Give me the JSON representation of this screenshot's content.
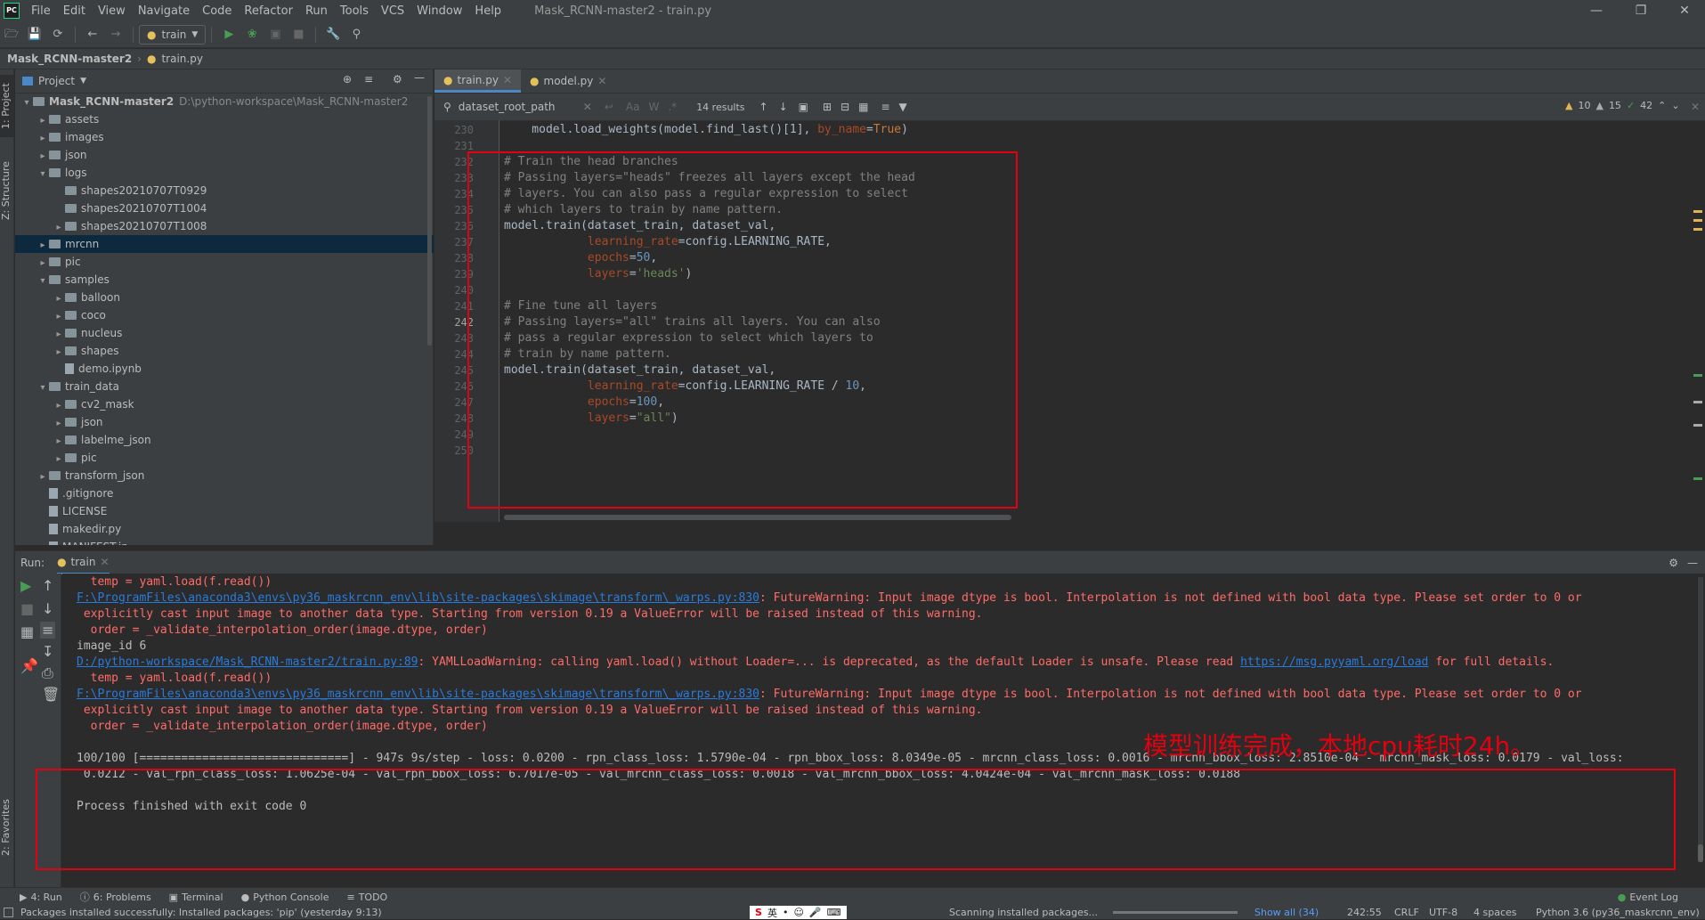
{
  "menu": {
    "app_icon": "PC",
    "items": [
      "File",
      "Edit",
      "View",
      "Navigate",
      "Code",
      "Refactor",
      "Run",
      "Tools",
      "VCS",
      "Window",
      "Help"
    ],
    "window_title": "Mask_RCNN-master2 - train.py",
    "window_controls": [
      "minimize-icon",
      "restore-icon",
      "close-icon"
    ]
  },
  "toolbar": {
    "run_config": "train",
    "icons": [
      "open-icon",
      "save-icon",
      "sync-icon",
      "back-icon",
      "forward-icon",
      "run-icon",
      "debug-icon",
      "coverage-icon",
      "stop-icon",
      "wrench-icon",
      "search-icon"
    ]
  },
  "breadcrumbs": [
    "Mask_RCNN-master2",
    "train.py"
  ],
  "stripe": {
    "project_tab": "1: Project",
    "structure_tab": "Z: Structure",
    "favorites_tab": "2: Favorites"
  },
  "project": {
    "header": "Project",
    "tree": [
      {
        "depth": 0,
        "open": true,
        "type": "folder",
        "label": "Mask_RCNN-master2",
        "path": "D:\\python-workspace\\Mask_RCNN-master2",
        "bold": true
      },
      {
        "depth": 1,
        "open": false,
        "type": "folder",
        "label": "assets"
      },
      {
        "depth": 1,
        "open": false,
        "type": "folder",
        "label": "images"
      },
      {
        "depth": 1,
        "open": false,
        "type": "folder",
        "label": "json"
      },
      {
        "depth": 1,
        "open": true,
        "type": "folder",
        "label": "logs"
      },
      {
        "depth": 2,
        "open": null,
        "type": "folder",
        "label": "shapes20210707T0929"
      },
      {
        "depth": 2,
        "open": null,
        "type": "folder",
        "label": "shapes20210707T1004"
      },
      {
        "depth": 2,
        "open": false,
        "type": "folder",
        "label": "shapes20210707T1008"
      },
      {
        "depth": 1,
        "open": false,
        "type": "folder",
        "label": "mrcnn",
        "selected": true
      },
      {
        "depth": 1,
        "open": false,
        "type": "folder",
        "label": "pic"
      },
      {
        "depth": 1,
        "open": true,
        "type": "folder",
        "label": "samples"
      },
      {
        "depth": 2,
        "open": false,
        "type": "folder",
        "label": "balloon"
      },
      {
        "depth": 2,
        "open": false,
        "type": "folder",
        "label": "coco"
      },
      {
        "depth": 2,
        "open": false,
        "type": "folder",
        "label": "nucleus"
      },
      {
        "depth": 2,
        "open": false,
        "type": "folder",
        "label": "shapes"
      },
      {
        "depth": 2,
        "open": null,
        "type": "file",
        "label": "demo.ipynb"
      },
      {
        "depth": 1,
        "open": true,
        "type": "folder",
        "label": "train_data"
      },
      {
        "depth": 2,
        "open": false,
        "type": "folder",
        "label": "cv2_mask"
      },
      {
        "depth": 2,
        "open": false,
        "type": "folder",
        "label": "json"
      },
      {
        "depth": 2,
        "open": false,
        "type": "folder",
        "label": "labelme_json"
      },
      {
        "depth": 2,
        "open": false,
        "type": "folder",
        "label": "pic"
      },
      {
        "depth": 1,
        "open": false,
        "type": "folder",
        "label": "transform_json"
      },
      {
        "depth": 1,
        "open": null,
        "type": "file",
        "label": ".gitignore"
      },
      {
        "depth": 1,
        "open": null,
        "type": "file",
        "label": "LICENSE"
      },
      {
        "depth": 1,
        "open": null,
        "type": "file",
        "label": "makedir.py"
      },
      {
        "depth": 1,
        "open": null,
        "type": "file",
        "label": "MANIFEST.in"
      }
    ]
  },
  "editor": {
    "tabs": [
      {
        "label": "train.py",
        "active": true
      },
      {
        "label": "model.py",
        "active": false
      }
    ],
    "find": {
      "query": "dataset_root_path",
      "results": "14 results"
    },
    "inspections": {
      "warnings": "10",
      "weak": "15",
      "ok": "42"
    },
    "lines": [
      {
        "n": "230",
        "segs": [
          [
            "    model.load_weights(model.find_last()[1], ",
            "n"
          ],
          [
            "by_name",
            "k"
          ],
          [
            "=",
            "n"
          ],
          [
            "True",
            "c"
          ],
          [
            ")",
            "n"
          ]
        ]
      },
      {
        "n": "231",
        "segs": []
      },
      {
        "n": "232",
        "segs": [
          [
            "# Train the head branches",
            "m"
          ]
        ]
      },
      {
        "n": "233",
        "segs": [
          [
            "# Passing layers=\"heads\" freezes all layers except the head",
            "m"
          ]
        ]
      },
      {
        "n": "234",
        "segs": [
          [
            "# layers. You can also pass a regular expression to select",
            "m"
          ]
        ]
      },
      {
        "n": "235",
        "segs": [
          [
            "# which layers to train by name pattern.",
            "m"
          ]
        ]
      },
      {
        "n": "236",
        "segs": [
          [
            "model.train(dataset_train, dataset_val,",
            "n"
          ]
        ]
      },
      {
        "n": "237",
        "segs": [
          [
            "            ",
            "n"
          ],
          [
            "learning_rate",
            "k"
          ],
          [
            "=config.LEARNING_RATE,",
            "n"
          ]
        ]
      },
      {
        "n": "238",
        "segs": [
          [
            "            ",
            "n"
          ],
          [
            "epochs",
            "k"
          ],
          [
            "=",
            "n"
          ],
          [
            "50",
            "u"
          ],
          [
            ",",
            "n"
          ]
        ]
      },
      {
        "n": "239",
        "segs": [
          [
            "            ",
            "n"
          ],
          [
            "layers",
            "k"
          ],
          [
            "=",
            "n"
          ],
          [
            "'heads'",
            "s"
          ],
          [
            ")",
            "n"
          ]
        ]
      },
      {
        "n": "240",
        "segs": []
      },
      {
        "n": "241",
        "segs": [
          [
            "# Fine tune all layers",
            "m"
          ]
        ]
      },
      {
        "n": "242",
        "segs": [
          [
            "# Passing layers=\"all\" trains all layers. You can also",
            "m"
          ]
        ]
      },
      {
        "n": "243",
        "segs": [
          [
            "# pass a regular expression to select which layers to",
            "m"
          ]
        ]
      },
      {
        "n": "244",
        "segs": [
          [
            "# train by name pattern.",
            "m"
          ]
        ]
      },
      {
        "n": "245",
        "segs": [
          [
            "model.train(dataset_train, dataset_val,",
            "n"
          ]
        ]
      },
      {
        "n": "246",
        "segs": [
          [
            "            ",
            "n"
          ],
          [
            "learning_rate",
            "k"
          ],
          [
            "=config.LEARNING_RATE / ",
            "n"
          ],
          [
            "10",
            "u"
          ],
          [
            ",",
            "n"
          ]
        ]
      },
      {
        "n": "247",
        "segs": [
          [
            "            ",
            "n"
          ],
          [
            "epochs",
            "k"
          ],
          [
            "=",
            "n"
          ],
          [
            "100",
            "u"
          ],
          [
            ",",
            "n"
          ]
        ]
      },
      {
        "n": "248",
        "segs": [
          [
            "            ",
            "n"
          ],
          [
            "layers",
            "k"
          ],
          [
            "=",
            "n"
          ],
          [
            "\"all\"",
            "s"
          ],
          [
            ")",
            "n"
          ]
        ]
      },
      {
        "n": "249",
        "segs": []
      },
      {
        "n": "250",
        "segs": []
      }
    ]
  },
  "run": {
    "label": "Run:",
    "tab": "train",
    "console": [
      [
        [
          "  temp = yaml.load(f.read())",
          "e"
        ]
      ],
      [
        [
          "F:\\ProgramFiles\\anaconda3\\envs\\py36_maskrcnn_env\\lib\\site-packages\\skimage\\transform\\_warps.py:830",
          "l"
        ],
        [
          ": FutureWarning: Input image dtype is bool. Interpolation is not defined with bool data type. Please set order to 0 or",
          "e"
        ]
      ],
      [
        [
          " explicitly cast input image to another data type. Starting from version 0.19 a ValueError will be raised instead of this warning.",
          "e"
        ]
      ],
      [
        [
          "  order = _validate_interpolation_order(image.dtype, order)",
          "e"
        ]
      ],
      [
        [
          "image_id 6",
          "n"
        ]
      ],
      [
        [
          "D:/python-workspace/Mask_RCNN-master2/train.py:89",
          "l"
        ],
        [
          ": YAMLLoadWarning: calling yaml.load() without Loader=... is deprecated, as the default Loader is unsafe. Please read ",
          "e"
        ],
        [
          "https://msg.pyyaml.org/load",
          "l"
        ],
        [
          " for full details.",
          "e"
        ]
      ],
      [
        [
          "  temp = yaml.load(f.read())",
          "e"
        ]
      ],
      [
        [
          "F:\\ProgramFiles\\anaconda3\\envs\\py36_maskrcnn_env\\lib\\site-packages\\skimage\\transform\\_warps.py:830",
          "l"
        ],
        [
          ": FutureWarning: Input image dtype is bool. Interpolation is not defined with bool data type. Please set order to 0 or",
          "e"
        ]
      ],
      [
        [
          " explicitly cast input image to another data type. Starting from version 0.19 a ValueError will be raised instead of this warning.",
          "e"
        ]
      ],
      [
        [
          "  order = _validate_interpolation_order(image.dtype, order)",
          "e"
        ]
      ],
      [],
      [
        [
          "100/100 [==============================] - 947s 9s/step - loss: 0.0200 - rpn_class_loss: 1.5790e-04 - rpn_bbox_loss: 8.0349e-05 - mrcnn_class_loss: 0.0016 - mrcnn_bbox_loss: 2.8510e-04 - mrcnn_mask_loss: 0.0179 - val_loss:",
          "n"
        ]
      ],
      [
        [
          " 0.0212 - val_rpn_class_loss: 1.0625e-04 - val_rpn_bbox_loss: 6.7017e-05 - val_mrcnn_class_loss: 0.0018 - val_mrcnn_bbox_loss: 4.0424e-04 - val_mrcnn_mask_loss: 0.0188",
          "n"
        ]
      ],
      [],
      [
        [
          "Process finished with exit code 0",
          "n"
        ]
      ]
    ],
    "annotation": "模型训练完成，本地cpu耗时24h。"
  },
  "tools": [
    {
      "icon": "run-icon",
      "label": "4: Run"
    },
    {
      "icon": "problems-icon",
      "label": "6: Problems"
    },
    {
      "icon": "terminal-icon",
      "label": "Terminal"
    },
    {
      "icon": "python-icon",
      "label": "Python Console"
    },
    {
      "icon": "todo-icon",
      "label": "TODO"
    }
  ],
  "event_log": "Event Log",
  "status": {
    "message": "Packages installed successfully: Installed packages: 'pip' (yesterday 9:13)",
    "ime": "英",
    "scanning": "Scanning installed packages...",
    "show_all": "Show all (34)",
    "position": "242:55",
    "line_sep": "CRLF",
    "encoding": "UTF-8",
    "indent": "4 spaces",
    "interpreter": "Python 3.6 (py36_maskrcnn_env)"
  },
  "colors": {
    "accent": "#4a88c7",
    "highlight_box": "#e3000f",
    "annotation_text": "#e3000f"
  }
}
